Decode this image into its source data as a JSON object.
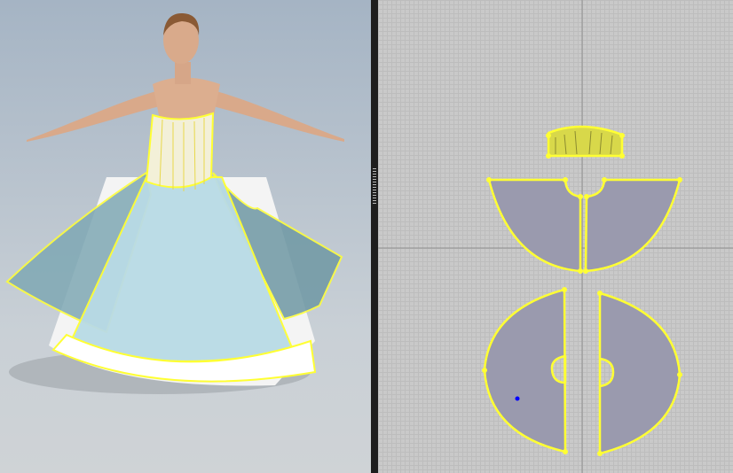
{
  "app": {
    "layout": "split-view",
    "left_panel": "3d-viewport",
    "right_panel": "2d-pattern-window"
  },
  "colors": {
    "pattern_outline": "#ffff33",
    "pattern_fill": "#9a9aae",
    "background_3d": "#b5c0cb",
    "background_2d": "#c9c9c9",
    "selected_point": "#0000ff"
  }
}
